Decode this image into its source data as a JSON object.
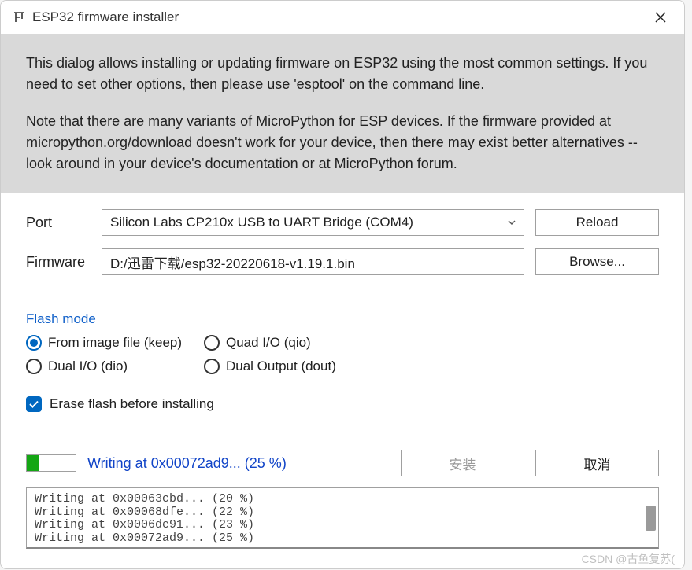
{
  "window": {
    "title": "ESP32 firmware installer"
  },
  "intro": {
    "p1": "This dialog allows installing or updating firmware on ESP32 using the most common settings. If you need to set other options, then please use 'esptool' on the command line.",
    "p2": "Note that there are many variants of MicroPython for ESP devices. If the firmware provided at micropython.org/download doesn't work for your device, then there may exist better alternatives -- look around in your device's documentation or at MicroPython forum."
  },
  "form": {
    "port_label": "Port",
    "port_value": "Silicon Labs CP210x USB to UART Bridge (COM4)",
    "reload_label": "Reload",
    "firmware_label": "Firmware",
    "firmware_value": "D:/迅雷下载/esp32-20220618-v1.19.1.bin",
    "browse_label": "Browse..."
  },
  "flash_mode": {
    "legend": "Flash mode",
    "options": {
      "keep": "From image file (keep)",
      "qio": "Quad I/O (qio)",
      "dio": "Dual I/O (dio)",
      "dout": "Dual Output (dout)"
    },
    "selected": "keep"
  },
  "erase": {
    "label": "Erase flash before installing",
    "checked": true
  },
  "progress": {
    "status_text": "Writing at 0x00072ad9... (25 %)",
    "percent": 25,
    "install_label": "安装",
    "cancel_label": "取消"
  },
  "log": {
    "lines": [
      "Writing at 0x00063cbd... (20 %)",
      "Writing at 0x00068dfe... (22 %)",
      "Writing at 0x0006de91... (23 %)",
      "Writing at 0x00072ad9... (25 %)"
    ]
  },
  "watermark": "CSDN @古鱼复苏("
}
